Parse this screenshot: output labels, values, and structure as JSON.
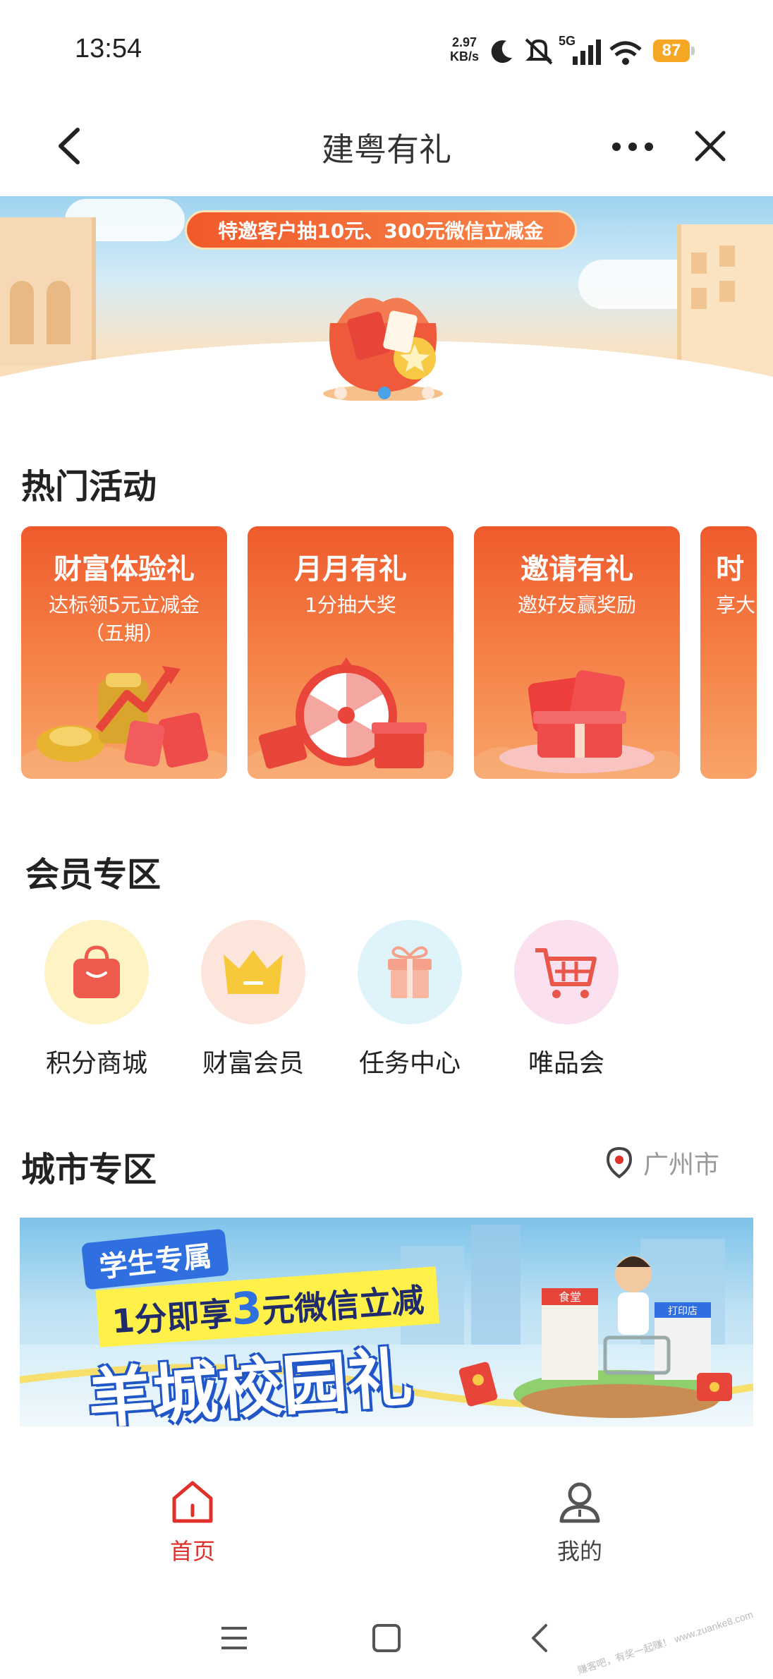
{
  "status_bar": {
    "time": "13:54",
    "net_speed_value": "2.97",
    "net_speed_unit": "KB/s",
    "network": "5G",
    "battery": "87",
    "icons": [
      "moon-icon",
      "mute-icon",
      "signal-icon",
      "wifi-icon",
      "battery-icon"
    ]
  },
  "nav": {
    "title": "建粤有礼",
    "back_icon": "chevron-left-icon",
    "more_icon": "more-dots-icon",
    "close_icon": "close-icon"
  },
  "banner": {
    "pill_text": "特邀客户抽10元、300元微信立减金",
    "dots_count": 3,
    "active_dot": 2
  },
  "hot_activities": {
    "title": "热门活动",
    "cards": [
      {
        "title": "财富体验礼",
        "subtitle": "达标领5元立减金\n（五期）"
      },
      {
        "title": "月月有礼",
        "subtitle": "1分抽大奖"
      },
      {
        "title": "邀请有礼",
        "subtitle": "邀好友赢奖励"
      },
      {
        "title": "时",
        "subtitle": "享大"
      }
    ]
  },
  "member_zone": {
    "title": "会员专区",
    "items": [
      {
        "label": "积分商城",
        "icon": "shopping-bag-icon",
        "bg": "#fdf3c4",
        "fg": "#ee5b4d"
      },
      {
        "label": "财富会员",
        "icon": "crown-icon",
        "bg": "#fce6dc",
        "fg": "#f7c83a"
      },
      {
        "label": "任务中心",
        "icon": "gift-box-icon",
        "bg": "#dff3fb",
        "fg": "#f6a28a"
      },
      {
        "label": "唯品会",
        "icon": "shopping-cart-icon",
        "bg": "#fbe1ef",
        "fg": "#e9564a"
      }
    ]
  },
  "city_zone": {
    "title": "城市专区",
    "location": "广州市",
    "location_icon": "location-pin-icon",
    "banner": {
      "tag": "学生专属",
      "headline_prefix": "1分即享",
      "headline_number": "3",
      "headline_suffix": "元微信立减",
      "main_text": "羊城校园礼",
      "shop_sign_1": "食堂",
      "shop_sign_2": "打印店"
    }
  },
  "bottom_tabs": [
    {
      "label": "首页",
      "icon": "home-icon",
      "active": true
    },
    {
      "label": "我的",
      "icon": "user-icon",
      "active": false
    }
  ],
  "system_nav": {
    "icons": [
      "menu-icon",
      "home-square-icon",
      "back-icon"
    ]
  },
  "watermark": "赚客吧，有奖一起赚！ www.zuanke8.com",
  "colors": {
    "accent_red": "#e0302a",
    "card_orange": "#ef5a2c",
    "active_dot": "#4aa3e6"
  }
}
